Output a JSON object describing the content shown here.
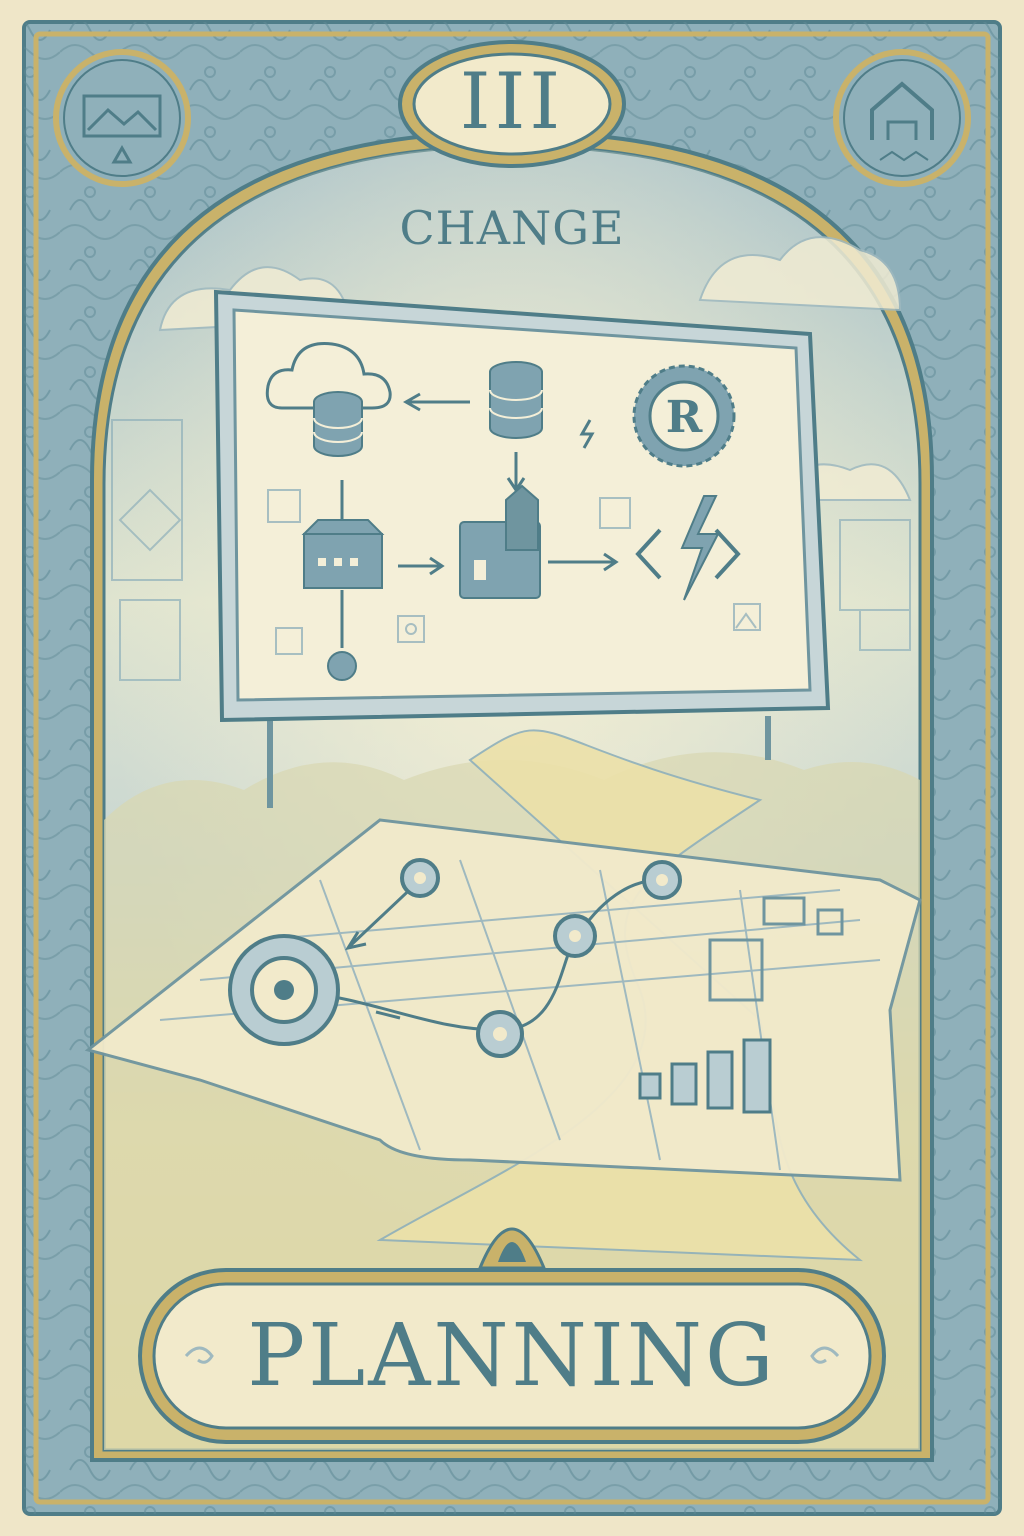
{
  "card": {
    "numeral": "III",
    "subtitle": "CHANGE",
    "title": "PLANNING"
  },
  "colors": {
    "paper": "#efe6c8",
    "frame_blue": "#7fa3b0",
    "ink": "#4f7d88",
    "gold": "#c9b26a",
    "sky": "#b9cdd2"
  },
  "icons": {
    "corner_left": "landscape-frame-icon",
    "corner_right": "house-icon",
    "board": [
      "cloud-icon",
      "database-icon",
      "rust-gear-icon",
      "building-icon",
      "house-icon",
      "lightning-code-icon",
      "node-icon"
    ],
    "bottom_ornament": "triangle-eye-icon"
  }
}
